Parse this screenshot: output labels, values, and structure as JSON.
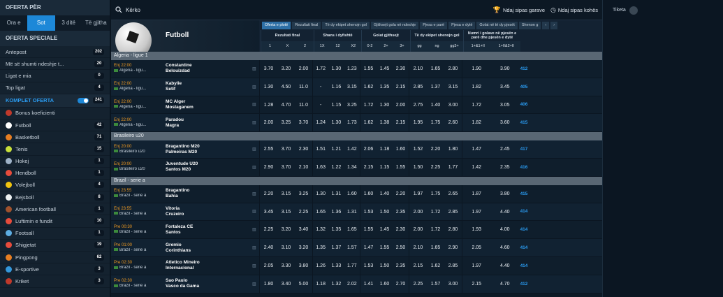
{
  "sidebar": {
    "oferta_header": "OFERTA PËR",
    "tabs": [
      "Ora e",
      "Sot",
      "3 ditë",
      "Të gjitha"
    ],
    "special_header": "OFERTA SPECIALE",
    "special": [
      {
        "label": "Antepost",
        "count": "202"
      },
      {
        "label": "Më së shumti ndeshje t...",
        "count": "20"
      },
      {
        "label": "Ligat e mia",
        "count": "0"
      },
      {
        "label": "Top ligat",
        "count": "4"
      }
    ],
    "komplet": {
      "label": "KOMPLET OFERTA",
      "count": "241"
    },
    "sports": [
      {
        "label": "Bonus koeficienti",
        "count": "",
        "color": "#c0392b"
      },
      {
        "label": "Futboll",
        "count": "42",
        "color": "#ffffff"
      },
      {
        "label": "Basketboll",
        "count": "71",
        "color": "#e67e22"
      },
      {
        "label": "Tenis",
        "count": "15",
        "color": "#c8e03a"
      },
      {
        "label": "Hokej",
        "count": "1",
        "color": "#9fb3c8"
      },
      {
        "label": "Hendboll",
        "count": "1",
        "color": "#e74c3c"
      },
      {
        "label": "Volejboll",
        "count": "4",
        "color": "#f1c40f"
      },
      {
        "label": "Bejsboll",
        "count": "8",
        "color": "#ecf0f1"
      },
      {
        "label": "American football",
        "count": "1",
        "color": "#a0522d"
      },
      {
        "label": "Luftimin e fundit",
        "count": "10",
        "color": "#e74c3c"
      },
      {
        "label": "Footsall",
        "count": "1",
        "color": "#5dade2"
      },
      {
        "label": "Shigjetat",
        "count": "19",
        "color": "#e74c3c"
      },
      {
        "label": "Pingpong",
        "count": "62",
        "color": "#e67e22"
      },
      {
        "label": "E-sportive",
        "count": "3",
        "color": "#3498db"
      },
      {
        "label": "Kriket",
        "count": "3",
        "color": "#c0392b"
      }
    ]
  },
  "search": {
    "label": "Kërko",
    "sort1": "Ndaj sipas garave",
    "sort2": "Ndaj sipas kohës"
  },
  "right": {
    "title": "Tiketa"
  },
  "header": {
    "sport": "Futboll",
    "market_tabs": [
      "Oferta e plotë",
      "Rezultati final",
      "Të dy ekipet shenojn gol",
      "Gjithsejt gola në ndeshje",
      "Pjesa e parë",
      "Pjesa e dytë",
      "Golat në të dy pjesët",
      "Shenon g"
    ],
    "groups": [
      {
        "title": "Rezultati final",
        "subs": [
          "1",
          "X",
          "2"
        ]
      },
      {
        "title": "Shans i dyfishtë",
        "subs": [
          "1X",
          "12",
          "X2"
        ]
      },
      {
        "title": "Golat gjithsejt",
        "subs": [
          "0-2",
          "2+",
          "3+"
        ]
      },
      {
        "title": "Të dy ekipet shenojn gol",
        "subs": [
          "gg",
          "ng",
          "gg3+"
        ]
      },
      {
        "title": "Numri i golave në pjesën e parë dhe pjesën e dytë",
        "subs": [
          "1+&1+II",
          "1+II&2+II"
        ]
      }
    ]
  },
  "leagues": [
    {
      "name": "Algeria - ligue 1",
      "matches": [
        {
          "time": "Enj 22:00",
          "league": "Algeria - ligu...",
          "home": "Constantine",
          "away": "Belouizdad",
          "odds": [
            "3.70",
            "3.20",
            "2.00",
            "1.72",
            "1.30",
            "1.23",
            "1.55",
            "1.45",
            "2.30",
            "2.10",
            "1.65",
            "2.80",
            "1.90",
            "3.90"
          ],
          "more": "412"
        },
        {
          "time": "Enj 22:00",
          "league": "Algeria - ligu...",
          "home": "Kabylie",
          "away": "Setif",
          "odds": [
            "1.30",
            "4.50",
            "11.0",
            "-",
            "1.16",
            "3.15",
            "1.62",
            "1.35",
            "2.15",
            "2.85",
            "1.37",
            "3.15",
            "1.82",
            "3.45"
          ],
          "more": "405"
        },
        {
          "time": "Enj 22:00",
          "league": "Algeria - ligu...",
          "home": "MC Alger",
          "away": "Mostaganem",
          "odds": [
            "1.28",
            "4.70",
            "11.0",
            "-",
            "1.15",
            "3.25",
            "1.72",
            "1.30",
            "2.00",
            "2.75",
            "1.40",
            "3.00",
            "1.72",
            "3.05"
          ],
          "more": "406"
        },
        {
          "time": "Enj 22:00",
          "league": "Algeria - ligu...",
          "home": "Paradou",
          "away": "Magra",
          "odds": [
            "2.00",
            "3.25",
            "3.70",
            "1.24",
            "1.30",
            "1.73",
            "1.62",
            "1.38",
            "2.15",
            "1.95",
            "1.75",
            "2.60",
            "1.82",
            "3.60"
          ],
          "more": "415"
        }
      ]
    },
    {
      "name": "Brasileiro u20",
      "matches": [
        {
          "time": "Enj 20:00",
          "league": "Brasileiro u20",
          "home": "Bragantino M20",
          "away": "Palmeiras M20",
          "odds": [
            "2.55",
            "3.70",
            "2.30",
            "1.51",
            "1.21",
            "1.42",
            "2.06",
            "1.18",
            "1.60",
            "1.52",
            "2.20",
            "1.80",
            "1.47",
            "2.45"
          ],
          "more": "417"
        },
        {
          "time": "Enj 20:00",
          "league": "Brasileiro u20",
          "home": "Juventude U20",
          "away": "Santos M20",
          "odds": [
            "2.90",
            "3.70",
            "2.10",
            "1.63",
            "1.22",
            "1.34",
            "2.15",
            "1.15",
            "1.55",
            "1.50",
            "2.25",
            "1.77",
            "1.42",
            "2.35"
          ],
          "more": "416"
        }
      ]
    },
    {
      "name": "Brazil - serie a",
      "matches": [
        {
          "time": "Enj 23:55",
          "league": "Brazil - serie a",
          "home": "Bragantino",
          "away": "Bahia",
          "odds": [
            "2.20",
            "3.15",
            "3.25",
            "1.30",
            "1.31",
            "1.60",
            "1.60",
            "1.40",
            "2.20",
            "1.97",
            "1.75",
            "2.65",
            "1.87",
            "3.80"
          ],
          "more": "415"
        },
        {
          "time": "Enj 23:55",
          "league": "Brazil - serie a",
          "home": "Vitoria",
          "away": "Cruzeiro",
          "odds": [
            "3.45",
            "3.15",
            "2.25",
            "1.65",
            "1.36",
            "1.31",
            "1.53",
            "1.50",
            "2.35",
            "2.00",
            "1.72",
            "2.85",
            "1.97",
            "4.40"
          ],
          "more": "414"
        },
        {
          "time": "Pre 00:30",
          "league": "Brazil - serie a",
          "home": "Fortaleza CE",
          "away": "Santos",
          "odds": [
            "2.25",
            "3.20",
            "3.40",
            "1.32",
            "1.35",
            "1.65",
            "1.55",
            "1.45",
            "2.30",
            "2.00",
            "1.72",
            "2.80",
            "1.93",
            "4.00"
          ],
          "more": "414"
        },
        {
          "time": "Pre 01:00",
          "league": "Brazil - serie a",
          "home": "Gremio",
          "away": "Corinthians",
          "odds": [
            "2.40",
            "3.10",
            "3.20",
            "1.35",
            "1.37",
            "1.57",
            "1.47",
            "1.55",
            "2.50",
            "2.10",
            "1.65",
            "2.90",
            "2.05",
            "4.60"
          ],
          "more": "414"
        },
        {
          "time": "Pre 02:30",
          "league": "Brazil - serie a",
          "home": "Atletico Mineiro",
          "away": "Internacional",
          "odds": [
            "2.05",
            "3.30",
            "3.80",
            "1.26",
            "1.33",
            "1.77",
            "1.53",
            "1.50",
            "2.35",
            "2.15",
            "1.62",
            "2.85",
            "1.97",
            "4.40"
          ],
          "more": "414"
        },
        {
          "time": "Pre 02:30",
          "league": "Brazil - serie a",
          "home": "Sao Paulo",
          "away": "Vasco da Gama",
          "odds": [
            "1.80",
            "3.40",
            "5.00",
            "1.18",
            "1.32",
            "2.02",
            "1.41",
            "1.60",
            "2.70",
            "2.25",
            "1.57",
            "3.00",
            "2.15",
            "4.70"
          ],
          "more": "412"
        }
      ]
    }
  ]
}
